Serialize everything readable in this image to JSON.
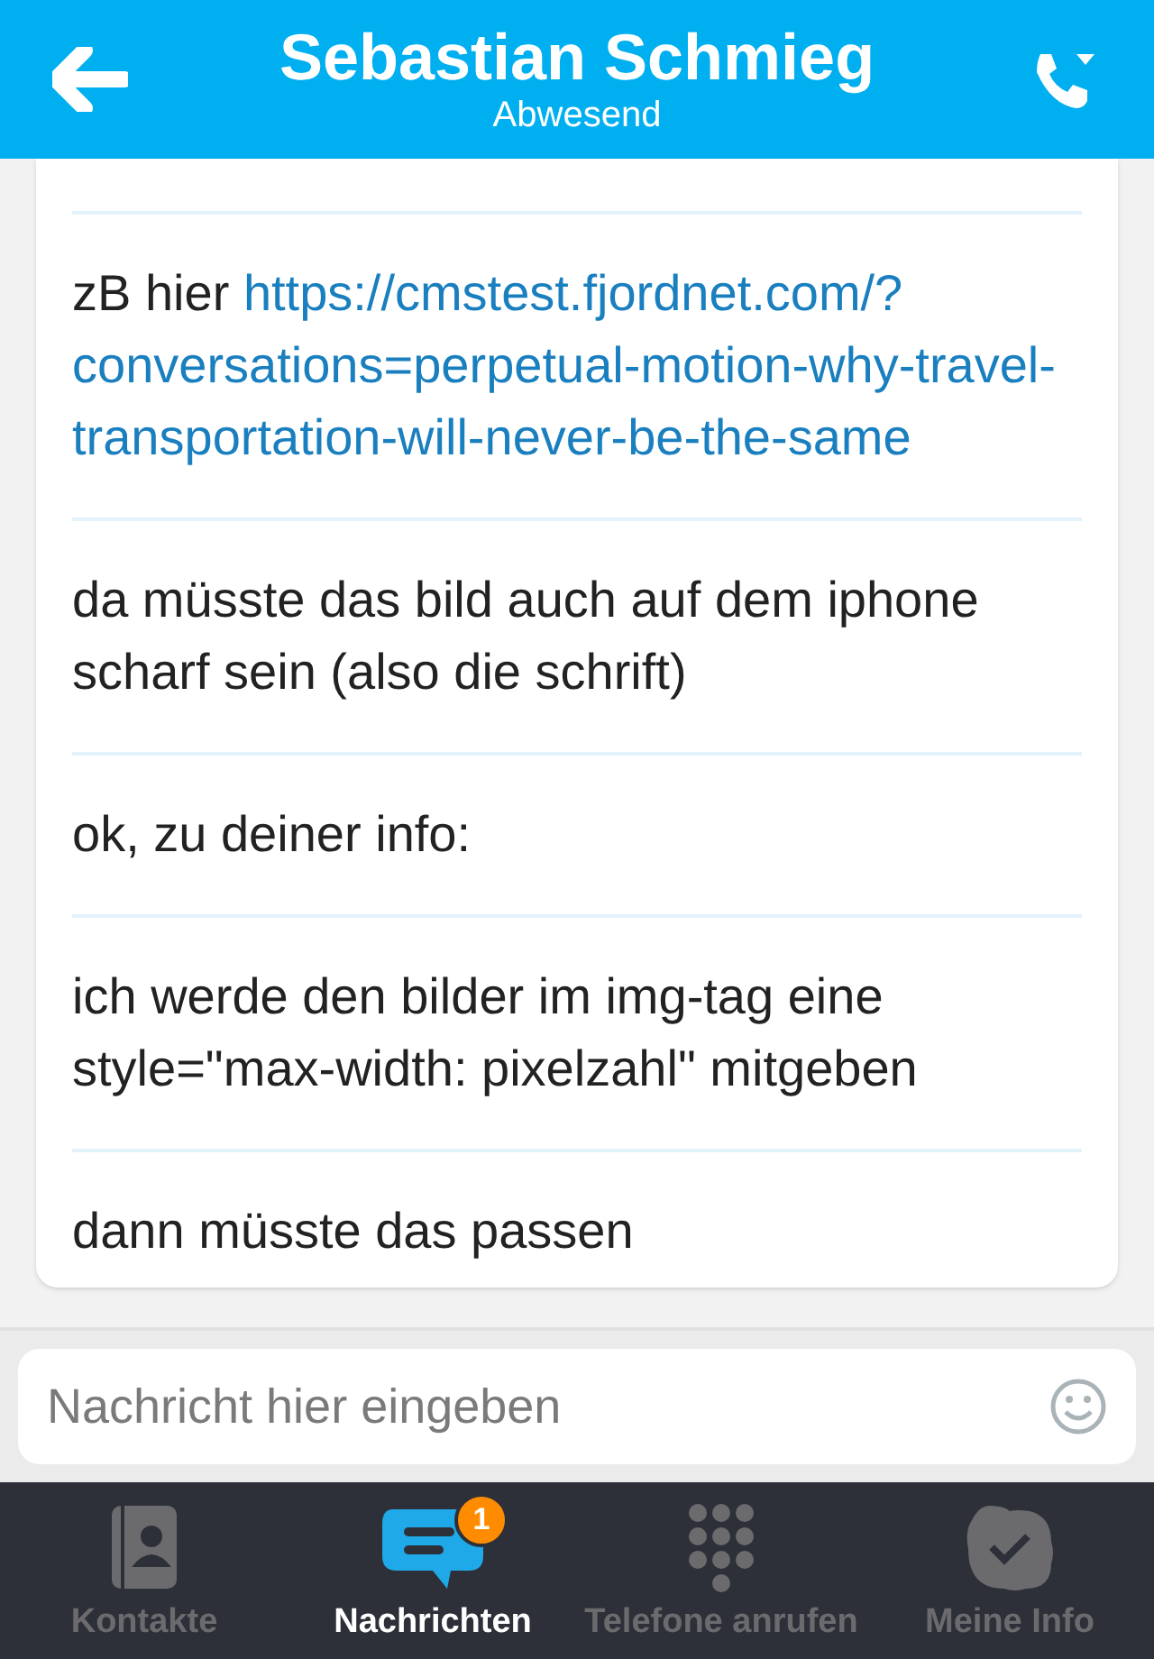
{
  "header": {
    "title": "Sebastian Schmieg",
    "status": "Abwesend"
  },
  "messages": [
    {
      "segments": [
        {
          "kind": "text",
          "text": "zB hier "
        },
        {
          "kind": "link",
          "text": "https://cmstest.fjordnet.com/?"
        },
        {
          "kind": "link",
          "text": "conversations=perpetual-motion-why-travel-"
        },
        {
          "kind": "link",
          "text": "transportation-will-never-be-the-same"
        }
      ]
    },
    {
      "segments": [
        {
          "kind": "text",
          "text": "da müsste das bild auch auf dem iphone scharf sein (also die schrift)"
        }
      ]
    },
    {
      "segments": [
        {
          "kind": "text",
          "text": "ok, zu deiner info:"
        }
      ]
    },
    {
      "segments": [
        {
          "kind": "text",
          "text": "ich werde den bilder im img-tag eine style=\"max-width: pixelzahl\" mitgeben"
        }
      ]
    },
    {
      "segments": [
        {
          "kind": "text",
          "text": "dann müsste das passen"
        }
      ]
    }
  ],
  "composer": {
    "placeholder": "Nachricht hier eingeben"
  },
  "tabs": [
    {
      "kind": "contacts",
      "label": "Kontakte",
      "selected": false
    },
    {
      "kind": "chat",
      "label": "Nachrichten",
      "selected": true,
      "badge": "1"
    },
    {
      "kind": "dialpad",
      "label": "Telefone anrufen",
      "selected": false
    },
    {
      "kind": "status",
      "label": "Meine Info",
      "selected": false
    }
  ]
}
